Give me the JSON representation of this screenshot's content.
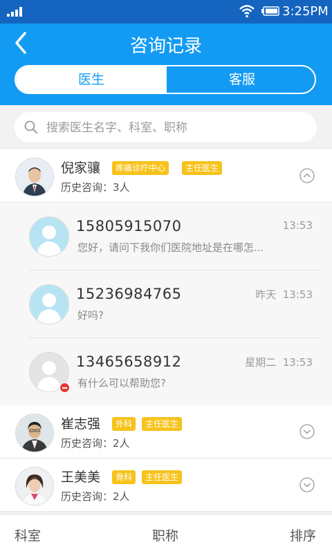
{
  "status": {
    "time": "3:25PM"
  },
  "header": {
    "title": "咨询记录",
    "seg_doctor": "医生",
    "seg_service": "客服"
  },
  "search": {
    "placeholder": "搜索医生名字、科室、职称"
  },
  "doctors": [
    {
      "name": "倪家骧",
      "tags": [
        "疼痛诊疗中心",
        "主任医生"
      ],
      "history": "历史咨询：3人",
      "expanded": true
    },
    {
      "name": "崔志强",
      "tags": [
        "外科",
        "主任医生"
      ],
      "history": "历史咨询：2人",
      "expanded": false
    },
    {
      "name": "王美美",
      "tags": [
        "骨科",
        "主任医生"
      ],
      "history": "历史咨询：2人",
      "expanded": false
    }
  ],
  "chats": [
    {
      "phone": "15805915070",
      "message": "您好，请问下我你们医院地址是在哪怎...",
      "day": "",
      "time": "13:53"
    },
    {
      "phone": "15236984765",
      "message": "好吗?",
      "day": "昨天",
      "time": "13:53"
    },
    {
      "phone": "13465658912",
      "message": "有什么可以帮助您?",
      "day": "星期二",
      "time": "13:53"
    }
  ],
  "bottom": {
    "dept": "科室",
    "title": "职称",
    "sort": "排序"
  },
  "colors": {
    "primary": "#139bf3",
    "tag": "#f7c21a",
    "badge": "#e53935"
  }
}
